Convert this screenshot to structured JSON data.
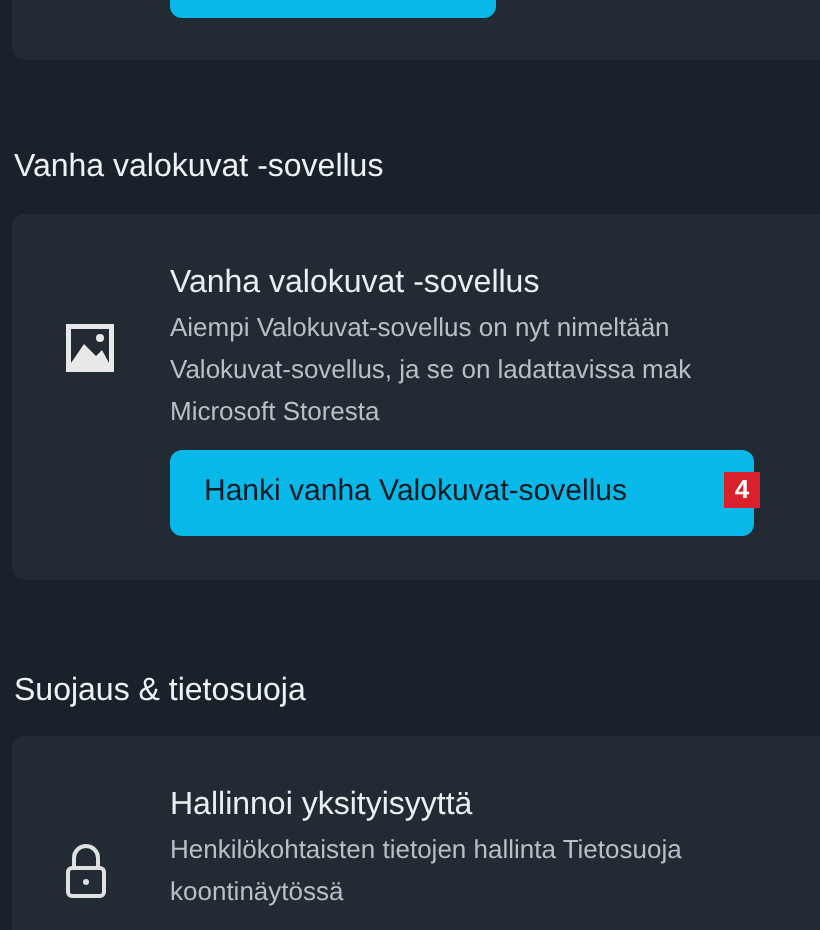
{
  "sections": [
    {
      "heading": "Vanha valokuvat -sovellus",
      "card": {
        "kind": "app",
        "title": "Vanha valokuvat -sovellus",
        "description_lines": [
          "Aiempi Valokuvat-sovellus on nyt nimeltään",
          "Valokuvat-sovellus, ja se on ladattavissa mak",
          "Microsoft Storesta"
        ],
        "button": {
          "label": "Hanki vanha Valokuvat-sovellus",
          "badge": "4"
        }
      }
    },
    {
      "heading": "Suojaus & tietosuoja",
      "card": {
        "kind": "privacy",
        "title": "Hallinnoi yksityisyyttä",
        "description_lines": [
          "Henkilökohtaisten tietojen hallinta Tietosuoja",
          "koontinäytössä"
        ]
      }
    }
  ]
}
